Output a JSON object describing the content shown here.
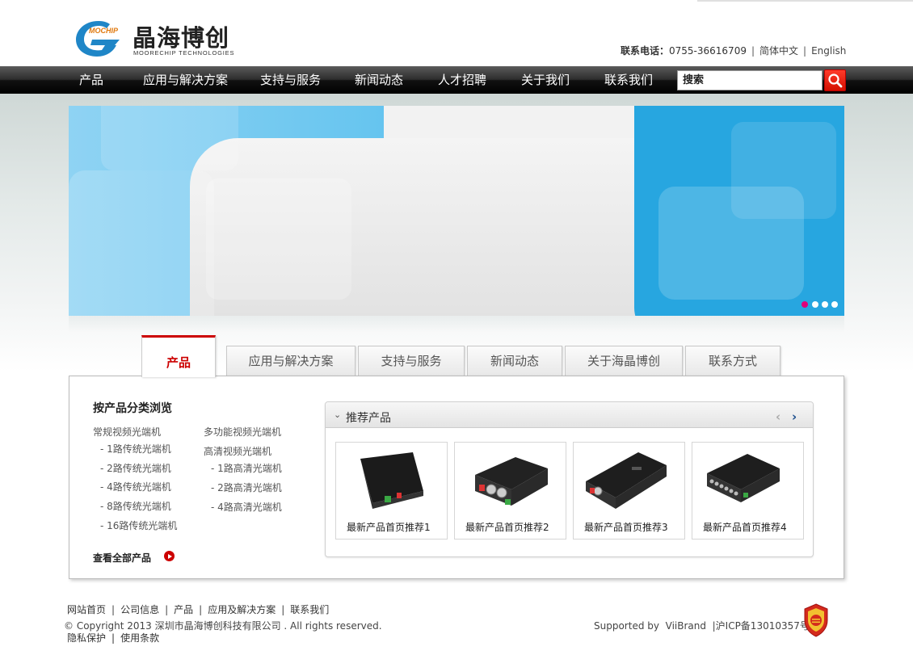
{
  "header": {
    "logo_mark_text": "MOCHIP",
    "logo_cn": "晶海博创",
    "logo_en": "MOORECHIP TECHNOLOGIES",
    "contact_label": "联系电话：",
    "contact_phone": "0755-36616709",
    "lang_cn": "简体中文",
    "lang_en": "English"
  },
  "nav": {
    "items": [
      "产品",
      "应用与解决方案",
      "支持与服务",
      "新闻动态",
      "人才招聘",
      "关于我们",
      "联系我们"
    ],
    "search_placeholder": "搜索"
  },
  "banner": {
    "slides": 4,
    "active_slide": 1
  },
  "tabs": [
    "产品",
    "应用与解决方案",
    "支持与服务",
    "新闻动态",
    "关于海晶博创",
    "联系方式"
  ],
  "active_tab": "产品",
  "categories": {
    "title": "按产品分类浏览",
    "left": [
      "常规视频光端机",
      "- 1路传统光端机",
      "- 2路传统光端机",
      "- 4路传统光端机",
      "- 8路传统光端机",
      "- 16路传统光端机"
    ],
    "right": [
      "多功能视频光端机",
      "高清视频光端机",
      "- 1路高清光端机",
      "- 2路高清光端机",
      "- 4路高清光端机"
    ],
    "view_all": "查看全部产品"
  },
  "recommended": {
    "title": "推荐产品",
    "products": [
      "最新产品首页推荐1",
      "最新产品首页推荐2",
      "最新产品首页推荐3",
      "最新产品首页推荐4"
    ]
  },
  "footer": {
    "links": [
      "网站首页",
      "公司信息",
      "产品",
      "应用及解决方案",
      "联系我们"
    ],
    "copyright": "© Copyright 2013  深圳市晶海博创科技有限公司  . All rights reserved.",
    "links2": [
      "隐私保护",
      "使用条款"
    ],
    "supported_label": "Supported by",
    "supported_brand": "ViiBrand",
    "icp": "沪ICP备13010357号"
  },
  "colors": {
    "accent": "#cc0000",
    "nav_bg": "#1a1a1a",
    "banner_blue": "#5cc1ee"
  }
}
